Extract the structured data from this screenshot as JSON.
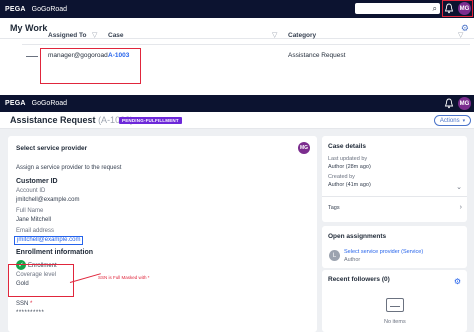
{
  "header_top": {
    "brand": "PEGA",
    "app": "GoGoRoad",
    "search_icon": "search-icon",
    "bell_icon": "bell-icon",
    "avatar": "MG"
  },
  "my_work": {
    "title": "My Work",
    "columns": [
      "Assigned To",
      "Case",
      "Category"
    ],
    "rows": [
      {
        "assigned_to": "manager@gogoroad",
        "case": "A-1003",
        "category": "Assistance Request"
      }
    ]
  },
  "header_case": {
    "brand": "PEGA",
    "app": "GoGoRoad",
    "avatar": "MG"
  },
  "case_header": {
    "title": "Assistance Request",
    "case_id": "(A-1003)",
    "status": "PENDING-FULFILLMENT",
    "actions_label": "Actions"
  },
  "assignment": {
    "title": "Select service provider",
    "avatar": "MG",
    "instruction": "Assign a service provider to the request",
    "customer_id": {
      "heading": "Customer ID",
      "account_id_label": "Account ID",
      "account_id_value": "jmitchell@example.com",
      "full_name_label": "Full Name",
      "full_name_value": "Jane Mitchell",
      "email_label": "Email address",
      "email_value": "jmitchell@example.com"
    },
    "enrollment": {
      "heading": "Enrollment information",
      "enrollment_label": "Enrollment",
      "coverage_label": "Coverage level",
      "coverage_value": "Gold",
      "ssn_label": "SSN",
      "ssn_required": "*",
      "ssn_value": "**********"
    },
    "annotation": "SSN is Full Masked with *"
  },
  "case_details": {
    "heading": "Case details",
    "last_updated_label": "Last updated by",
    "last_updated_value": "Author (28m ago)",
    "created_label": "Created by",
    "created_value": "Author (41m ago)",
    "tags_label": "Tags"
  },
  "open_assignments": {
    "heading": "Open assignments",
    "item_title": "Select service provider (Service)",
    "item_owner": "Author",
    "avatar": "L"
  },
  "followers": {
    "heading": "Recent followers (0)",
    "empty": "No items"
  },
  "colors": {
    "header_bg": "#0c1330",
    "accent": "#2563eb",
    "avatar": "#7b2d8e",
    "status_badge": "#6d28d9",
    "annotation": "#e0263c"
  }
}
